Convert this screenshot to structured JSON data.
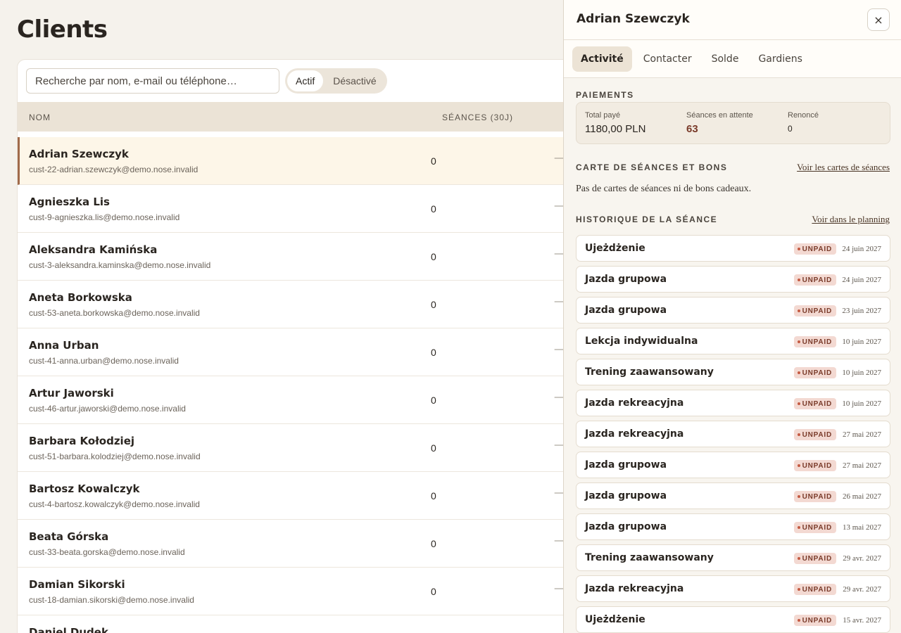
{
  "page_title": "Clients",
  "search": {
    "placeholder": "Recherche par nom, e-mail ou téléphone…"
  },
  "filter": {
    "active_label": "Actif",
    "inactive_label": "Désactivé"
  },
  "table": {
    "col_name": "NOM",
    "col_sessions": "SÉANCES (30J)",
    "rows": [
      {
        "name": "Adrian Szewczyk",
        "email": "cust-22-adrian.szewczyk@demo.nose.invalid",
        "sessions": "0",
        "extra": "—"
      },
      {
        "name": "Agnieszka Lis",
        "email": "cust-9-agnieszka.lis@demo.nose.invalid",
        "sessions": "0",
        "extra": "—"
      },
      {
        "name": "Aleksandra Kamińska",
        "email": "cust-3-aleksandra.kaminska@demo.nose.invalid",
        "sessions": "0",
        "extra": "—"
      },
      {
        "name": "Aneta Borkowska",
        "email": "cust-53-aneta.borkowska@demo.nose.invalid",
        "sessions": "0",
        "extra": "—"
      },
      {
        "name": "Anna Urban",
        "email": "cust-41-anna.urban@demo.nose.invalid",
        "sessions": "0",
        "extra": "—"
      },
      {
        "name": "Artur Jaworski",
        "email": "cust-46-artur.jaworski@demo.nose.invalid",
        "sessions": "0",
        "extra": "—"
      },
      {
        "name": "Barbara Kołodziej",
        "email": "cust-51-barbara.kolodziej@demo.nose.invalid",
        "sessions": "0",
        "extra": "—"
      },
      {
        "name": "Bartosz Kowalczyk",
        "email": "cust-4-bartosz.kowalczyk@demo.nose.invalid",
        "sessions": "0",
        "extra": "—"
      },
      {
        "name": "Beata Górska",
        "email": "cust-33-beata.gorska@demo.nose.invalid",
        "sessions": "0",
        "extra": "—"
      },
      {
        "name": "Damian Sikorski",
        "email": "cust-18-damian.sikorski@demo.nose.invalid",
        "sessions": "0",
        "extra": "—"
      },
      {
        "name": "Daniel Dudek",
        "email": "",
        "sessions": "",
        "extra": ""
      }
    ]
  },
  "panel": {
    "title": "Adrian Szewczyk",
    "close_icon": "×",
    "tabs": [
      "Activité",
      "Contacter",
      "Solde",
      "Gardiens"
    ],
    "payments": {
      "label": "PAIEMENTS",
      "total_paid_label": "Total payé",
      "total_paid_value": "1180,00 PLN",
      "pending_label": "Séances en attente",
      "pending_value": "63",
      "waived_label": "Renoncé",
      "waived_value": "0"
    },
    "cards": {
      "label": "CARTE DE SÉANCES ET BONS",
      "link": "Voir les cartes de séances",
      "empty": "Pas de cartes de séances ni de bons cadeaux."
    },
    "history": {
      "label": "HISTORIQUE DE LA SÉANCE",
      "link": "Voir dans le planning",
      "items": [
        {
          "title": "Ujeżdżenie",
          "status": "UNPAID",
          "date": "24 juin 2027"
        },
        {
          "title": "Jazda grupowa",
          "status": "UNPAID",
          "date": "24 juin 2027"
        },
        {
          "title": "Jazda grupowa",
          "status": "UNPAID",
          "date": "23 juin 2027"
        },
        {
          "title": "Lekcja indywidualna",
          "status": "UNPAID",
          "date": "10 juin 2027"
        },
        {
          "title": "Trening zaawansowany",
          "status": "UNPAID",
          "date": "10 juin 2027"
        },
        {
          "title": "Jazda rekreacyjna",
          "status": "UNPAID",
          "date": "10 juin 2027"
        },
        {
          "title": "Jazda rekreacyjna",
          "status": "UNPAID",
          "date": "27 mai 2027"
        },
        {
          "title": "Jazda grupowa",
          "status": "UNPAID",
          "date": "27 mai 2027"
        },
        {
          "title": "Jazda grupowa",
          "status": "UNPAID",
          "date": "26 mai 2027"
        },
        {
          "title": "Jazda grupowa",
          "status": "UNPAID",
          "date": "13 mai 2027"
        },
        {
          "title": "Trening zaawansowany",
          "status": "UNPAID",
          "date": "29 avr. 2027"
        },
        {
          "title": "Jazda rekreacyjna",
          "status": "UNPAID",
          "date": "29 avr. 2027"
        },
        {
          "title": "Ujeżdżenie",
          "status": "UNPAID",
          "date": "15 avr. 2027"
        }
      ]
    }
  },
  "colors": {
    "background": "#f5f2ec",
    "accent": "#a06a4a",
    "selected_row": "#fdf6e8",
    "badge_bg": "#f3d9d2",
    "badge_text": "#7a3b2a"
  }
}
